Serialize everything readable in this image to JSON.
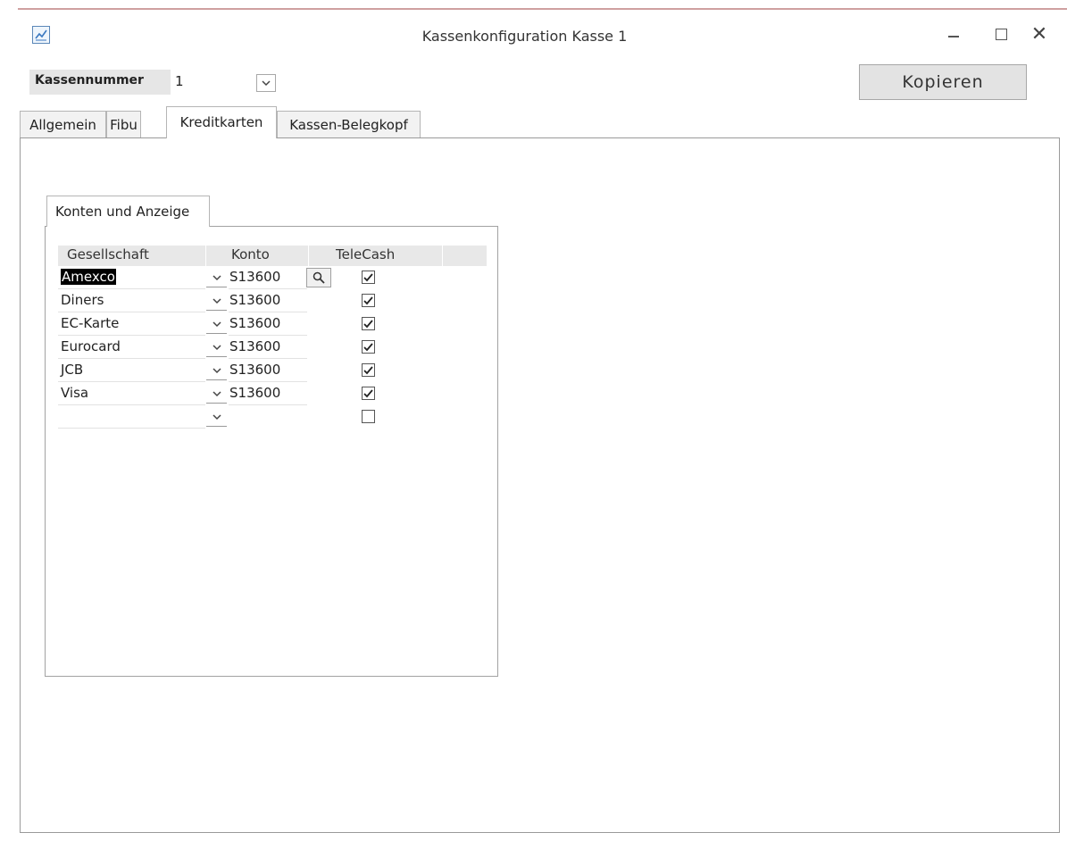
{
  "window": {
    "title": "Kassenkonfiguration Kasse 1",
    "icon": "chart-window-icon",
    "controls": [
      "minimize-icon",
      "maximize-icon",
      "close-icon"
    ],
    "close_glyph": "✕"
  },
  "header": {
    "kassennummer_label": "Kassennummer",
    "kassennummer_value": "1",
    "copy_button": "Kopieren"
  },
  "tabs": [
    {
      "label": "Allgemein",
      "active": false
    },
    {
      "label": "Fibu",
      "active": false
    },
    {
      "label": "Kreditkarten",
      "active": true
    },
    {
      "label": "Kassen-Belegkopf",
      "active": false
    }
  ],
  "subtab": {
    "label": "Konten und Anzeige"
  },
  "grid": {
    "columns": [
      "Gesellschaft",
      "Konto",
      "TeleCash"
    ],
    "rows": [
      {
        "gesellschaft": "Amexco",
        "konto": "S13600",
        "telecash": true,
        "selected": true
      },
      {
        "gesellschaft": "Diners",
        "konto": "S13600",
        "telecash": true,
        "selected": false
      },
      {
        "gesellschaft": "EC-Karte",
        "konto": "S13600",
        "telecash": true,
        "selected": false
      },
      {
        "gesellschaft": "Eurocard",
        "konto": "S13600",
        "telecash": true,
        "selected": false
      },
      {
        "gesellschaft": "JCB",
        "konto": "S13600",
        "telecash": true,
        "selected": false
      },
      {
        "gesellschaft": "Visa",
        "konto": "S13600",
        "telecash": true,
        "selected": false
      },
      {
        "gesellschaft": "",
        "konto": "",
        "telecash": false,
        "selected": false
      }
    ]
  },
  "colors": {
    "header_label_bg": "#e6e6e6",
    "button_bg": "#e3e3e3",
    "selection_bg": "#000000"
  }
}
